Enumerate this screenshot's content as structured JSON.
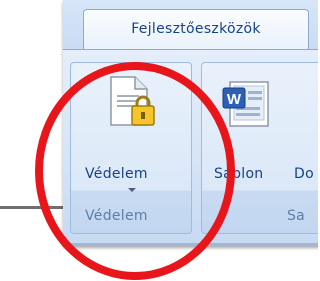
{
  "ribbon": {
    "active_tab": "Fejlesztőeszközök",
    "groups": [
      {
        "name": "Védelem",
        "buttons": [
          {
            "label": "Védelem",
            "icon": "protect-document-icon",
            "has_dropdown": true
          }
        ]
      },
      {
        "name": "Sa",
        "buttons": [
          {
            "label": "Sablon",
            "icon": "document-template-icon"
          },
          {
            "label": "Do",
            "icon": ""
          }
        ]
      }
    ]
  },
  "annotation": {
    "shape": "ellipse",
    "color": "#e8151b"
  },
  "colors": {
    "ribbon_text": "#15428b",
    "group_label_text": "#5d7fa8",
    "annotation": "#e8151b"
  }
}
